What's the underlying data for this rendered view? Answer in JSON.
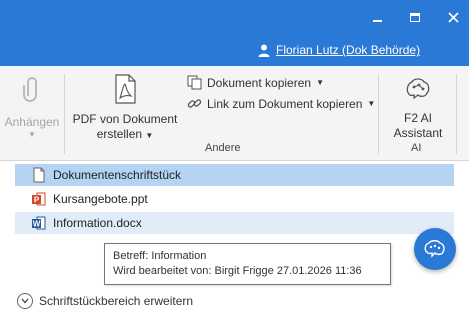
{
  "user": {
    "name": "Florian Lutz (Dok Behörde)"
  },
  "ribbon": {
    "attach": {
      "label": "Anhängen"
    },
    "pdf": {
      "label1": "PDF von Dokument",
      "label2": "erstellen"
    },
    "copy_doc": {
      "label": "Dokument kopieren"
    },
    "copy_link": {
      "label": "Link zum Dokument kopieren"
    },
    "ai": {
      "label1": "F2 AI",
      "label2": "Assistant"
    },
    "groups": {
      "other": "Andere",
      "ai": "AI"
    }
  },
  "files": [
    {
      "name": "Dokumentenschriftstück",
      "type": "blank",
      "state": "selected"
    },
    {
      "name": "Kursangebote.ppt",
      "type": "powerpoint",
      "state": "normal"
    },
    {
      "name": "Information.docx",
      "type": "word",
      "state": "hover"
    }
  ],
  "tooltip": {
    "line1": "Betreff: Information",
    "line2": "Wird bearbeitet von: Birgit Frigge 27.01.2026 11:36"
  },
  "expand": {
    "label": "Schriftstückbereich erweitern"
  },
  "colors": {
    "accent": "#2b79d7",
    "selected_row": "#b5d3f2",
    "hover_row": "#e1ecf8",
    "ppt": "#d24726",
    "word": "#2b579a"
  }
}
